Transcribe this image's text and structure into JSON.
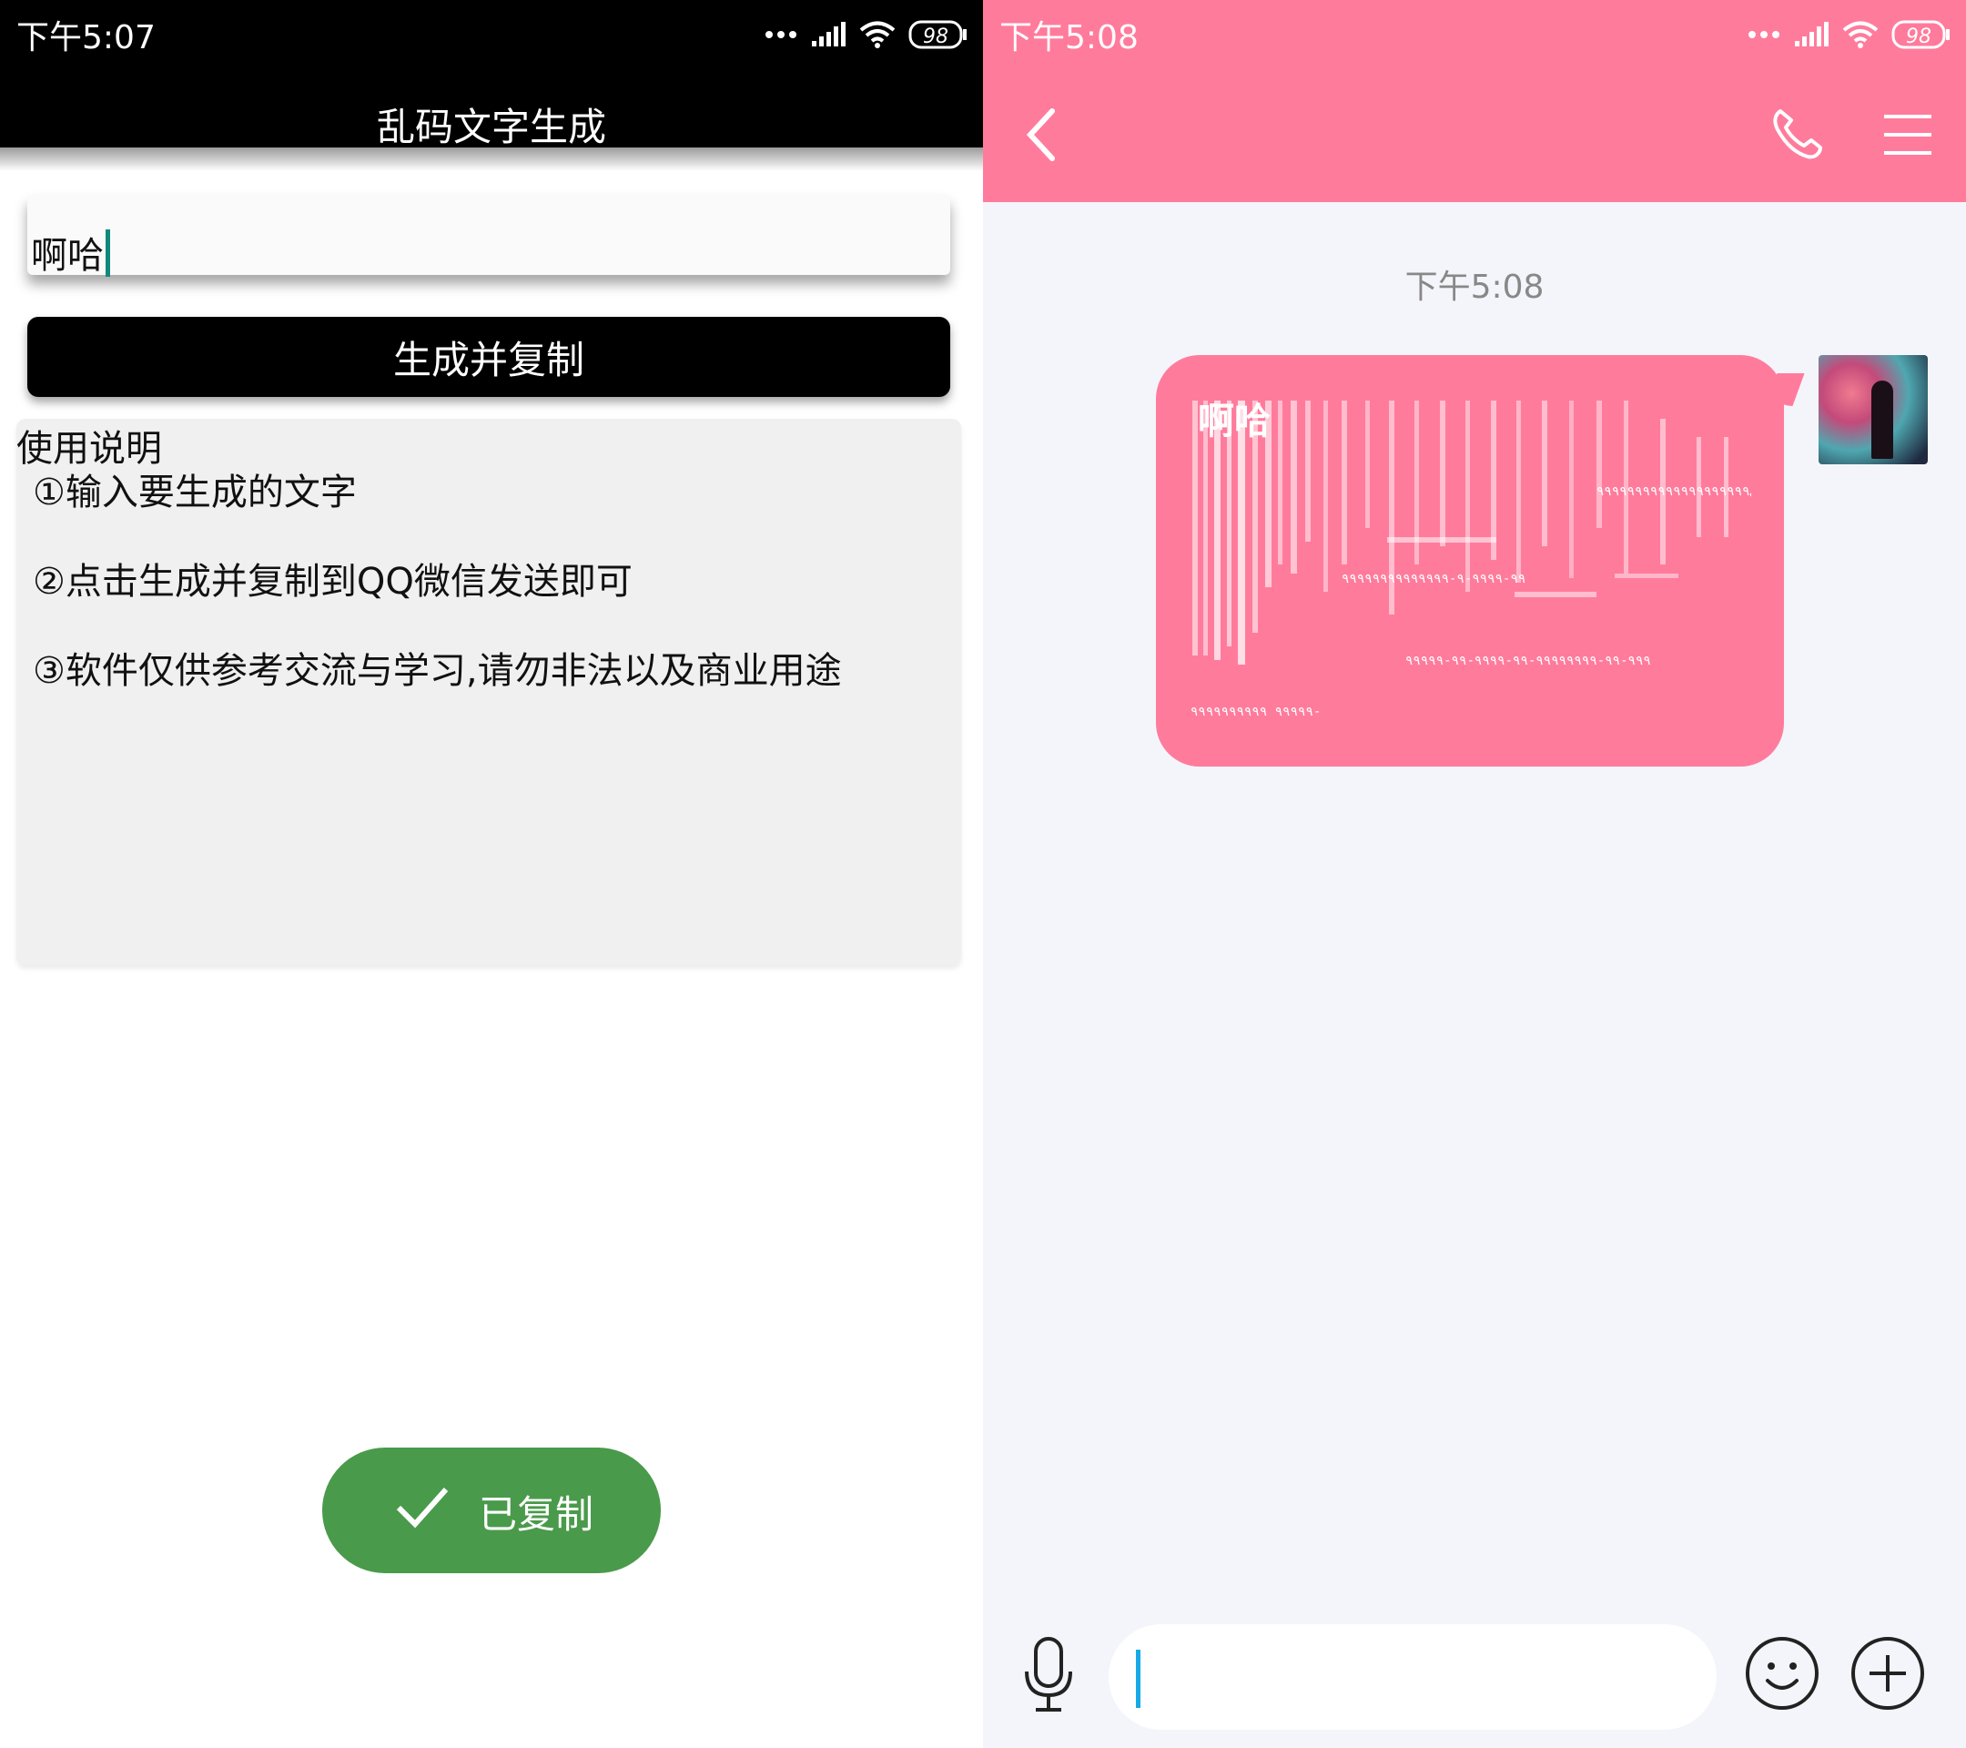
{
  "left": {
    "status": {
      "time": "下午5:07",
      "battery": "98"
    },
    "title": "乱码文字生成",
    "input_value": "啊哈",
    "generate_button": "生成并复制",
    "instructions": {
      "title": "使用说明",
      "items": [
        "①输入要生成的文字",
        "②点击生成并复制到QQ微信发送即可",
        "③软件仅供参考交流与学习,请勿非法以及商业用途"
      ]
    },
    "toast": "已复制"
  },
  "right": {
    "status": {
      "time": "下午5:08",
      "battery": "98"
    },
    "chat_time": "下午5:08",
    "message_text": "啊哈",
    "glitch_lines": [
      "ي٩٩٩٩٩٩٩٩٩٩٩٩٩٩٩٩٩٩٩٩",
      "٩٩-٩٩٩٩-٩-٩٩٩٩٩٩٩٩٩٩٩٩٩٩",
      "٩٩٩-٩٩-٩٩٩٩٩٩٩٩-٩٩-٩٩٩٩-٩٩-٩٩٩٩٩",
      "٩٩٩٩٩  ٩٩٩٩٩٩٩٩٩٩-"
    ]
  },
  "colors": {
    "pink": "#ff7b9c",
    "toast_green": "#4a9a4b",
    "chat_bg": "#f4f5fa"
  }
}
